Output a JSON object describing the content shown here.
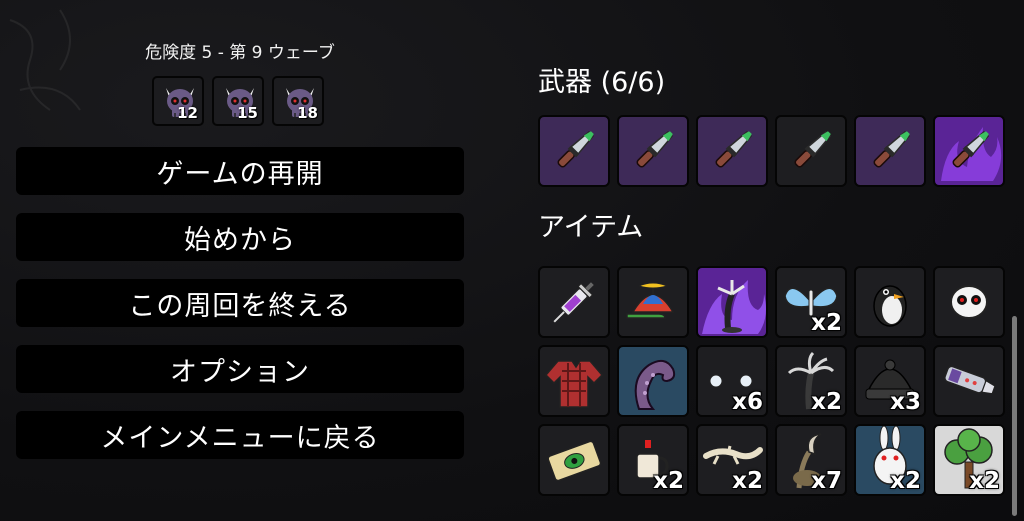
{
  "run": {
    "danger_wave": "危険度 5 - 第 9 ウェーブ",
    "skulls": [
      {
        "icon": "horned-skull-icon",
        "count": "12"
      },
      {
        "icon": "horned-skull-icon",
        "count": "15"
      },
      {
        "icon": "horned-skull-icon",
        "count": "18"
      }
    ]
  },
  "menu": {
    "resume": "ゲームの再開",
    "restart": "始めから",
    "end_run": "この周回を終える",
    "options": "オプション",
    "main_menu": "メインメニューに戻る"
  },
  "weapons": {
    "title": "武器 (6/6)",
    "slots": [
      {
        "icon": "knife-icon",
        "tier": "purple"
      },
      {
        "icon": "knife-icon",
        "tier": "purple"
      },
      {
        "icon": "knife-icon",
        "tier": "purple"
      },
      {
        "icon": "knife-icon",
        "tier": "common"
      },
      {
        "icon": "knife-icon",
        "tier": "purple"
      },
      {
        "icon": "knife-icon",
        "tier": "legendary"
      }
    ]
  },
  "items": {
    "title": "アイテム",
    "slots": [
      {
        "icon": "syringe-icon",
        "qty": ""
      },
      {
        "icon": "propeller-hat-icon",
        "qty": ""
      },
      {
        "icon": "dark-tree-icon",
        "qty": ""
      },
      {
        "icon": "butterfly-icon",
        "qty": "x2"
      },
      {
        "icon": "penguin-icon",
        "qty": ""
      },
      {
        "icon": "ghost-mask-icon",
        "qty": ""
      },
      {
        "icon": "plaid-shirt-icon",
        "qty": ""
      },
      {
        "icon": "tentacle-icon",
        "qty": ""
      },
      {
        "icon": "snowballs-icon",
        "qty": "x6"
      },
      {
        "icon": "claw-tree-icon",
        "qty": "x2"
      },
      {
        "icon": "beanie-icon",
        "qty": "x3"
      },
      {
        "icon": "gauntlet-icon",
        "qty": ""
      },
      {
        "icon": "treasure-map-icon",
        "qty": ""
      },
      {
        "icon": "coffee-cup-icon",
        "qty": "x2"
      },
      {
        "icon": "lizard-icon",
        "qty": "x2"
      },
      {
        "icon": "scythe-icon",
        "qty": "x7"
      },
      {
        "icon": "rabbit-icon",
        "qty": "x2"
      },
      {
        "icon": "tree-icon",
        "qty": "x2"
      }
    ]
  },
  "colors": {
    "tier_common": "#1e1e21",
    "tier_purple": "#3e2a58",
    "tier_legendary": "#5a2496",
    "tier_blue": "#2a4a62"
  }
}
